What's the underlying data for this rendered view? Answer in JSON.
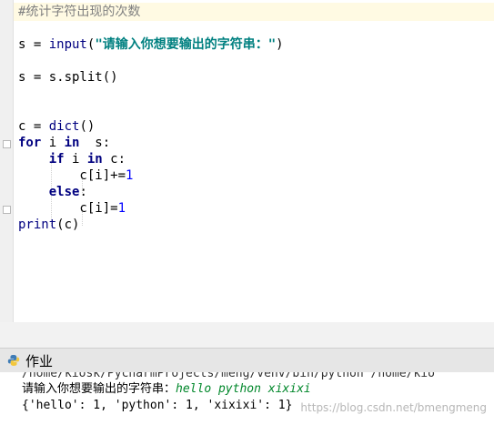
{
  "editor": {
    "lines": [
      [
        {
          "t": "#统计字符出现的次数",
          "c": "cmt"
        }
      ],
      [],
      [
        {
          "t": "s = ",
          "c": ""
        },
        {
          "t": "input",
          "c": "bi"
        },
        {
          "t": "(",
          "c": ""
        },
        {
          "t": "\"请输入你想要输出的字符串：\"",
          "c": "str"
        },
        {
          "t": ")",
          "c": ""
        }
      ],
      [],
      [
        {
          "t": "s = s.split()",
          "c": ""
        }
      ],
      [],
      [],
      [
        {
          "t": "c = ",
          "c": ""
        },
        {
          "t": "dict",
          "c": "bi"
        },
        {
          "t": "()",
          "c": ""
        }
      ],
      [
        {
          "t": "for",
          "c": "kw"
        },
        {
          "t": " i ",
          "c": ""
        },
        {
          "t": "in",
          "c": "kw"
        },
        {
          "t": "  s:",
          "c": ""
        }
      ],
      [
        {
          "t": "    ",
          "c": ""
        },
        {
          "t": "if",
          "c": "kw"
        },
        {
          "t": " i ",
          "c": ""
        },
        {
          "t": "in",
          "c": "kw"
        },
        {
          "t": " c:",
          "c": ""
        }
      ],
      [
        {
          "t": "        c[i]+=",
          "c": ""
        },
        {
          "t": "1",
          "c": "num"
        }
      ],
      [
        {
          "t": "    ",
          "c": ""
        },
        {
          "t": "else",
          "c": "kw"
        },
        {
          "t": ":",
          "c": ""
        }
      ],
      [
        {
          "t": "        c[i]=",
          "c": ""
        },
        {
          "t": "1",
          "c": "num"
        }
      ],
      [
        {
          "t": "print",
          "c": "bi"
        },
        {
          "t": "(c)",
          "c": ""
        }
      ]
    ]
  },
  "run_tab": {
    "label": "作业",
    "icon": "python-icon"
  },
  "console": {
    "path_line": "/home/kiosk/PycharmProjects/meng/venv/bin/python /home/kio",
    "prompt": "请输入你想要输出的字符串：",
    "user_input": "hello python xixixi",
    "output": "{'hello': 1, 'python': 1, 'xixixi': 1}"
  },
  "watermark": "https://blog.csdn.net/bmengmeng"
}
